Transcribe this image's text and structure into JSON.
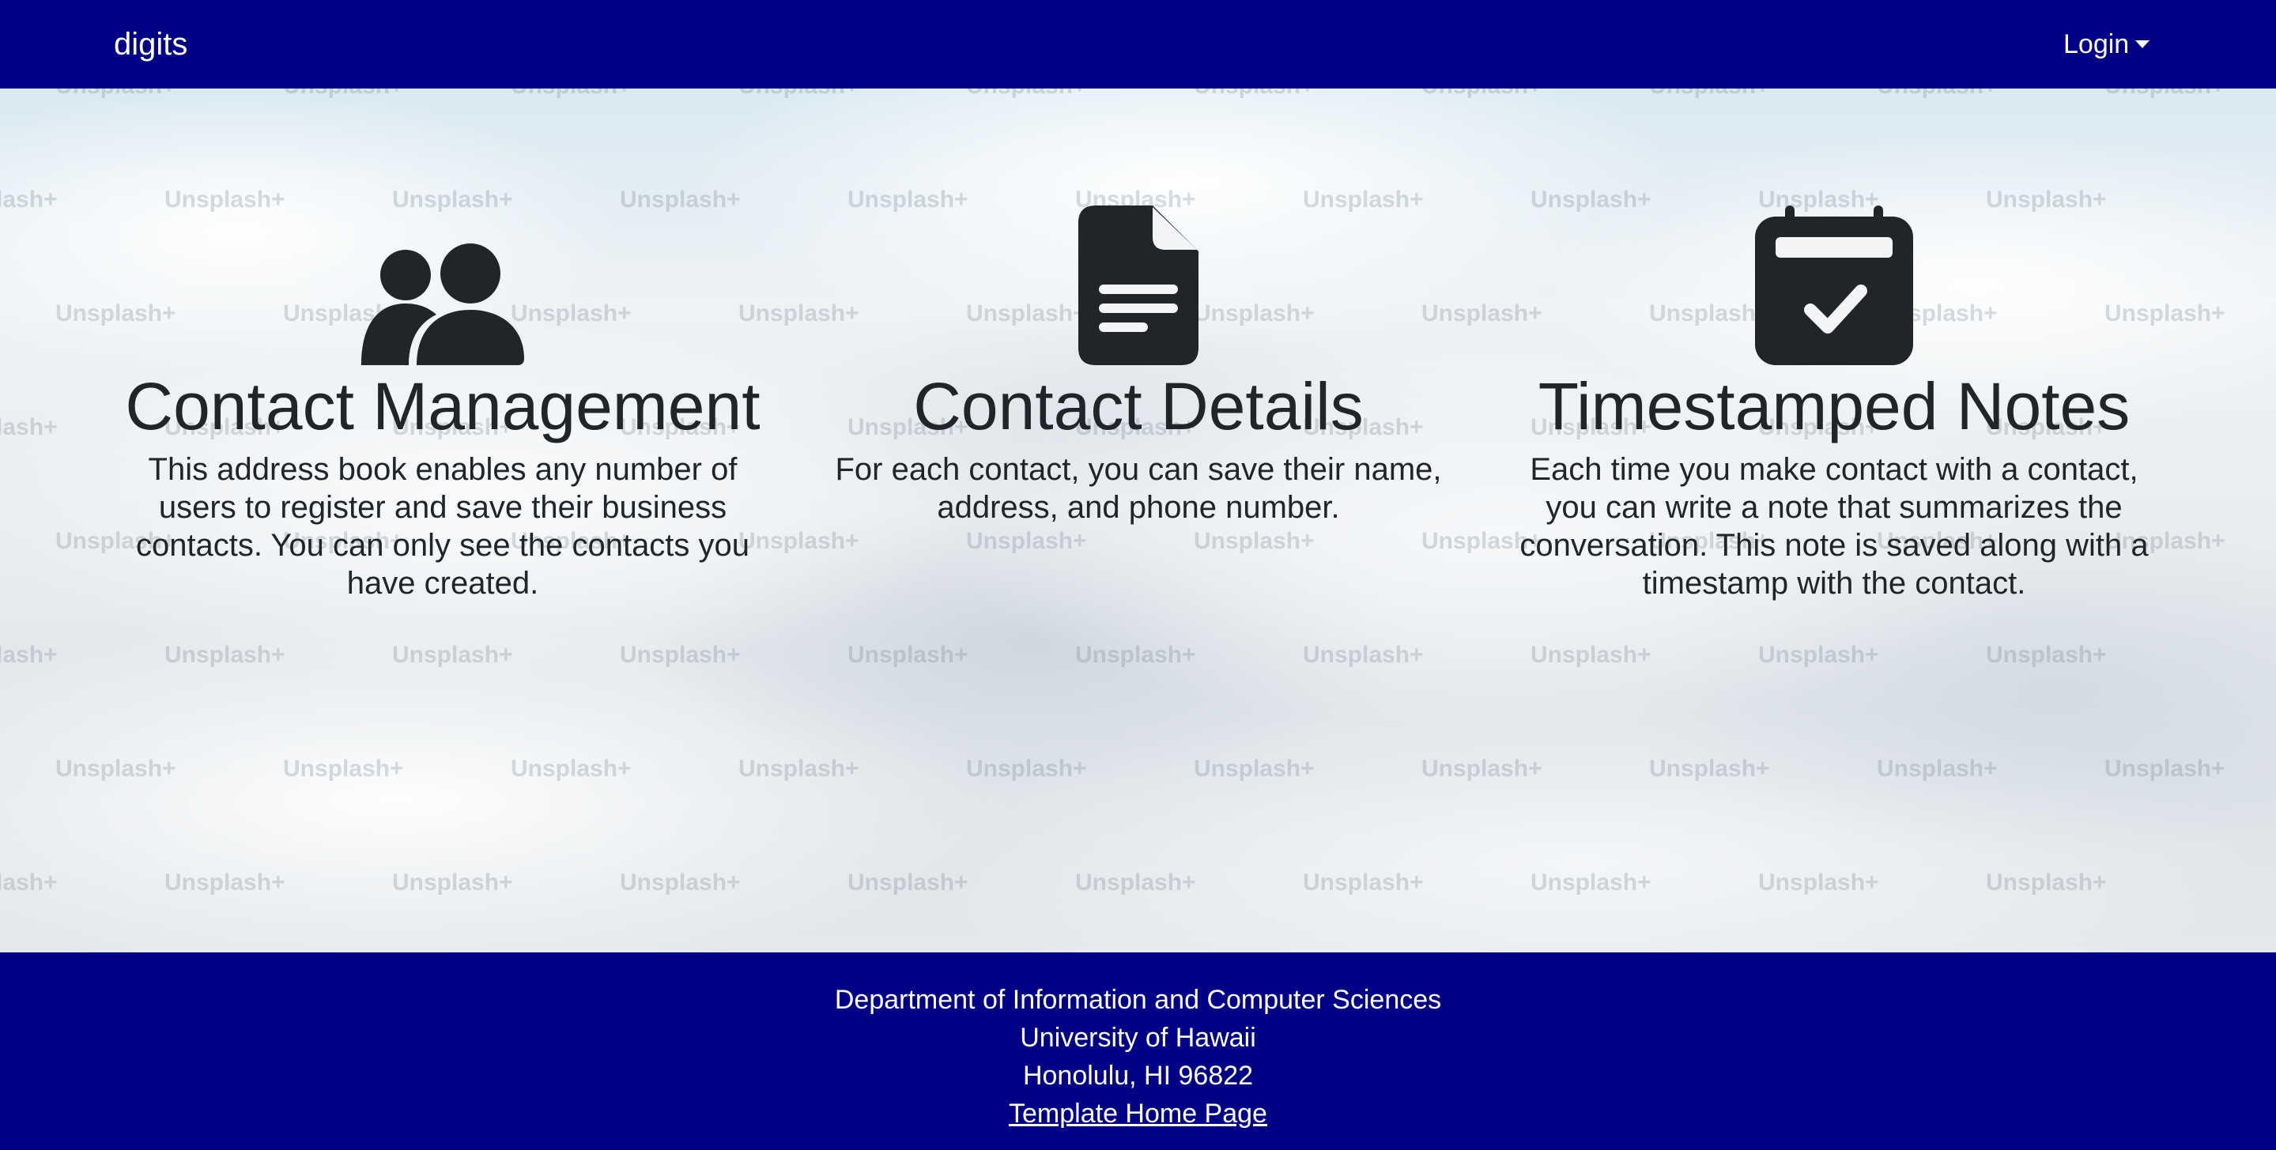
{
  "navbar": {
    "brand": "digits",
    "login_label": "Login",
    "background_color": "#000087"
  },
  "hero": {
    "watermark_text": "Unsplash+"
  },
  "features": [
    {
      "icon": "users-icon",
      "title": "Contact Management",
      "description": "This address book enables any number of users to register and save their business contacts. You can only see the contacts you have created."
    },
    {
      "icon": "file-lines-icon",
      "title": "Contact Details",
      "description": "For each contact, you can save their name, address, and phone number."
    },
    {
      "icon": "calendar-check-icon",
      "title": "Timestamped Notes",
      "description": "Each time you make contact with a contact, you can write a note that summarizes the conversation. This note is saved along with a timestamp with the contact."
    }
  ],
  "footer": {
    "line1": "Department of Information and Computer Sciences",
    "line2": "University of Hawaii",
    "line3": "Honolulu, HI 96822",
    "link_label": "Template Home Page",
    "background_color": "#000087"
  },
  "colors": {
    "text_dark": "#212529",
    "text_light": "#ffffff"
  }
}
